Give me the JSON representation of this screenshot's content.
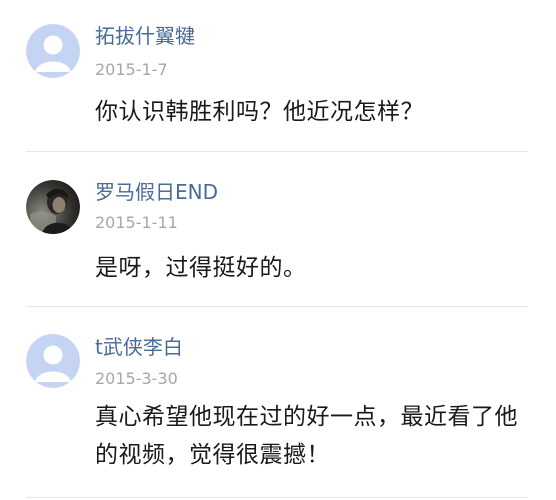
{
  "comments": [
    {
      "username": "拓拔什翼犍",
      "date": "2015-1-7",
      "text": "你认识韩胜利吗？他近况怎样？",
      "avatar": "default-avatar-icon",
      "avatar_color": "#c5d4f2"
    },
    {
      "username": "罗马假日END",
      "date": "2015-1-11",
      "text": "是呀，过得挺好的。",
      "avatar": "user-photo-avatar"
    },
    {
      "username": "t武侠李白",
      "date": "2015-3-30",
      "text": "真心希望他现在过的好一点，最近看了他的视频，觉得很震撼！",
      "avatar": "default-avatar-icon",
      "avatar_color": "#c5d4f2"
    }
  ],
  "colors": {
    "username": "#4a6b96",
    "date": "#a7a7a7",
    "text": "#1a1a1a",
    "divider": "#e6e6e6"
  }
}
